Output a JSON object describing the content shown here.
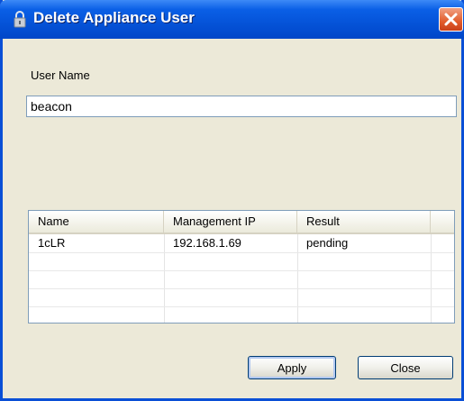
{
  "window": {
    "title": "Delete Appliance User",
    "accent_color": "#0a5fe6",
    "close_color": "#e25c2c"
  },
  "form": {
    "username_label": "User Name",
    "username_value": "beacon"
  },
  "table": {
    "columns": [
      "Name",
      "Management IP",
      "Result"
    ],
    "rows": [
      [
        "1cLR",
        "192.168.1.69",
        "pending"
      ]
    ]
  },
  "buttons": {
    "apply": "Apply",
    "close": "Close"
  },
  "icons": {
    "title": "lock-icon",
    "close": "close-icon"
  }
}
